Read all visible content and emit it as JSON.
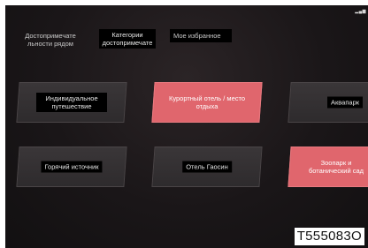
{
  "status": {
    "signal_icon": "signal-bars-icon"
  },
  "tabs": [
    {
      "label": "Достопримечате льности рядом",
      "active": false
    },
    {
      "label": "Категории достопримечате",
      "active": true
    },
    {
      "label": "Мое избранное",
      "active": false
    }
  ],
  "categories": [
    {
      "label": "Индивидуальное путешествие",
      "selected": false
    },
    {
      "label": "Курортный отель / место отдыха",
      "selected": true
    },
    {
      "label": "Аквапарк",
      "selected": false
    },
    {
      "label": "Горячий источник",
      "selected": false
    },
    {
      "label": "Отель Гаосин",
      "selected": false
    },
    {
      "label": "Зоопарк и ботанический сад",
      "selected": true
    }
  ],
  "image_code": "T555083O",
  "colors": {
    "background": "#1a1618",
    "tile_dark": "#353133",
    "tile_highlight": "#e0666d",
    "label_bg": "#000000"
  }
}
